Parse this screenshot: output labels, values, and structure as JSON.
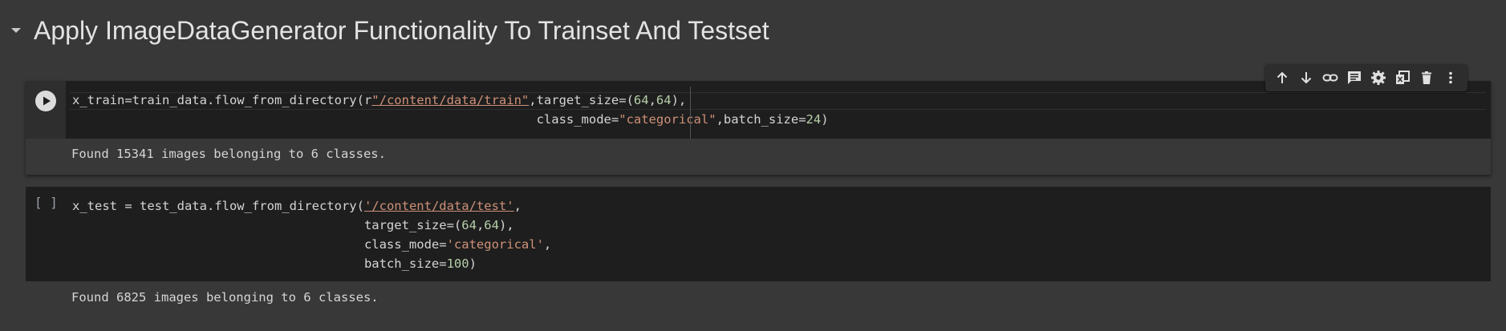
{
  "section": {
    "title": "Apply ImageDataGenerator Functionality To Trainset And Testset"
  },
  "cells": [
    {
      "status": "run",
      "code_lines": [
        {
          "parts": [
            {
              "t": "x_train=train_data.flow_from_directory(r",
              "c": "plain"
            },
            {
              "t": "\"/content/data/train\"",
              "c": "path"
            },
            {
              "t": ",target_size=(",
              "c": "plain"
            },
            {
              "t": "64",
              "c": "num"
            },
            {
              "t": ",",
              "c": "plain"
            },
            {
              "t": "64",
              "c": "num"
            },
            {
              "t": "),",
              "c": "plain"
            }
          ]
        },
        {
          "parts": [
            {
              "t": "                                                              class_mode=",
              "c": "plain"
            },
            {
              "t": "\"categorical\"",
              "c": "str"
            },
            {
              "t": ",batch_size=",
              "c": "plain"
            },
            {
              "t": "24",
              "c": "num"
            },
            {
              "t": ")",
              "c": "plain"
            }
          ]
        }
      ],
      "output": "Found 15341 images belonging to 6 classes."
    },
    {
      "status": "[ ]",
      "code_lines": [
        {
          "parts": [
            {
              "t": "x_test = test_data.flow_from_directory(",
              "c": "plain"
            },
            {
              "t": "'/content/data/test'",
              "c": "path"
            },
            {
              "t": ",",
              "c": "plain"
            }
          ]
        },
        {
          "parts": [
            {
              "t": "                                       target_size=(",
              "c": "plain"
            },
            {
              "t": "64",
              "c": "num"
            },
            {
              "t": ",",
              "c": "plain"
            },
            {
              "t": "64",
              "c": "num"
            },
            {
              "t": "),",
              "c": "plain"
            }
          ]
        },
        {
          "parts": [
            {
              "t": "                                       class_mode=",
              "c": "plain"
            },
            {
              "t": "'categorical'",
              "c": "str"
            },
            {
              "t": ",",
              "c": "plain"
            }
          ]
        },
        {
          "parts": [
            {
              "t": "                                       batch_size=",
              "c": "plain"
            },
            {
              "t": "100",
              "c": "num"
            },
            {
              "t": ")",
              "c": "plain"
            }
          ]
        }
      ],
      "output": "Found 6825 images belonging to 6 classes."
    }
  ],
  "toolbar": {
    "buttons": [
      "arrow-up-icon",
      "arrow-down-icon",
      "link-icon",
      "comment-icon",
      "gear-icon",
      "mirror-cell-icon",
      "trash-icon",
      "more-vert-icon"
    ]
  },
  "colors": {
    "background": "#383838",
    "cell": "#1e1e1e",
    "string": "#ce9178",
    "number": "#b5cea8"
  }
}
